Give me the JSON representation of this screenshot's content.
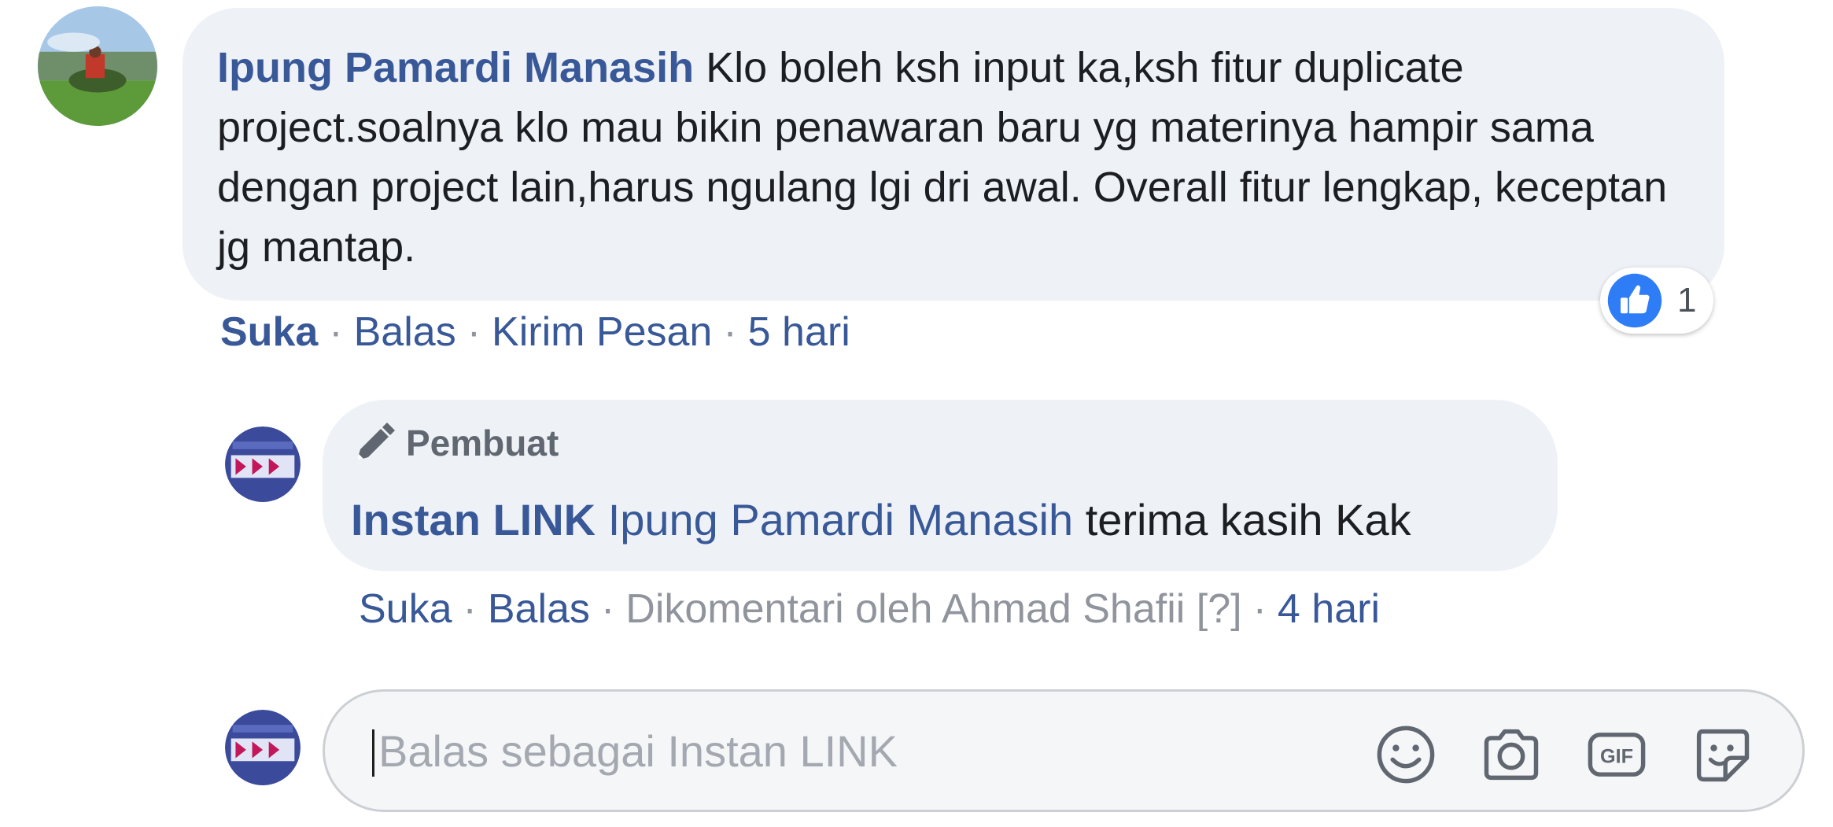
{
  "comment": {
    "author": "Ipung Pamardi Manasih",
    "text": "Klo boleh ksh input ka,ksh fitur duplicate project.soalnya klo mau bikin penawaran baru yg materinya hampir sama dengan project lain,harus ngulang lgi dri awal. Overall fitur lengkap, keceptan jg mantap.",
    "actions": {
      "like": "Suka",
      "reply": "Balas",
      "message": "Kirim Pesan",
      "time": "5 hari"
    },
    "reaction_count": "1",
    "reaction_icon": "like-icon"
  },
  "reply": {
    "badge": "Pembuat",
    "author": "Instan LINK",
    "mention": "Ipung Pamardi Manasih",
    "text": "terima kasih Kak",
    "actions": {
      "like": "Suka",
      "reply": "Balas",
      "commented_by": "Dikomentari oleh Ahmad Shafii",
      "help": "[?]",
      "time": "4 hari"
    }
  },
  "composer": {
    "placeholder": "Balas sebagai Instan LINK",
    "icons": [
      "emoji-icon",
      "camera-icon",
      "gif-icon",
      "sticker-icon"
    ]
  },
  "colors": {
    "link": "#385898",
    "bubble": "#eef2f7",
    "muted": "#90949c",
    "like_blue": "#2e7cf6"
  }
}
